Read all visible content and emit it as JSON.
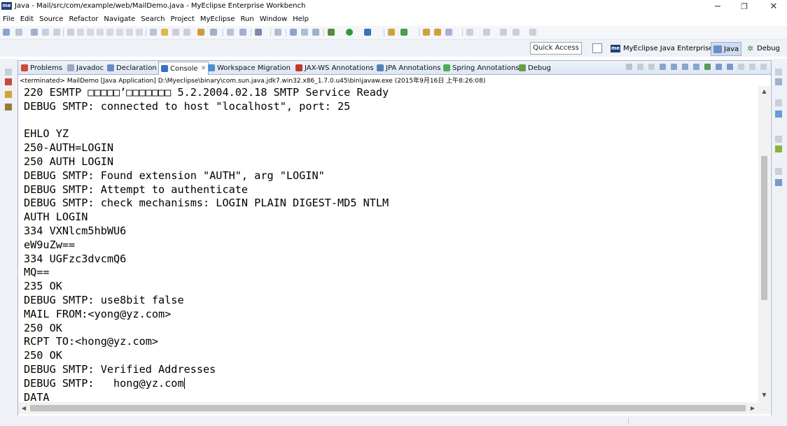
{
  "window": {
    "app_logo": "me",
    "title": "Java - Mail/src/com/example/web/MailDemo.java - MyEclipse Enterprise Workbench",
    "minimize": "−",
    "maximize": "❐",
    "close": "✕"
  },
  "menu": [
    "File",
    "Edit",
    "Source",
    "Refactor",
    "Navigate",
    "Search",
    "Project",
    "MyEclipse",
    "Run",
    "Window",
    "Help"
  ],
  "quick_access": "Quick Access",
  "perspectives": {
    "myeclipse": "MyEclipse Java Enterprise",
    "java": "Java",
    "debug": "Debug"
  },
  "view_tabs": [
    {
      "label": "Problems",
      "color": "#d04a3a"
    },
    {
      "label": "Javadoc",
      "color": "#9aa8c0"
    },
    {
      "label": "Declaration",
      "color": "#6a8ac8"
    },
    {
      "label": "Console",
      "color": "#3a6fc4",
      "active": true
    },
    {
      "label": "Workspace Migration",
      "color": "#4d8fd6"
    },
    {
      "label": "JAX-WS Annotations",
      "color": "#c0392b"
    },
    {
      "label": "JPA Annotations",
      "color": "#5a7fb8"
    },
    {
      "label": "Spring Annotations",
      "color": "#4caf50"
    },
    {
      "label": "Debug",
      "color": "#6a9a4a"
    }
  ],
  "console": {
    "launch_info": "<terminated> MailDemo [Java Application] D:\\Myeclipse\\binary\\com.sun.java.jdk7.win32.x86_1.7.0.u45\\bin\\javaw.exe (2015年9月16日 上午8:26:08)",
    "lines": [
      "220 ESMTP □□□□□’□□□□□□□ 5.2.2004.02.18 SMTP Service Ready",
      "DEBUG SMTP: connected to host \"localhost\", port: 25",
      "",
      "EHLO YZ",
      "250-AUTH=LOGIN",
      "250 AUTH LOGIN",
      "DEBUG SMTP: Found extension \"AUTH\", arg \"LOGIN\"",
      "DEBUG SMTP: Attempt to authenticate",
      "DEBUG SMTP: check mechanisms: LOGIN PLAIN DIGEST-MD5 NTLM",
      "AUTH LOGIN",
      "334 VXNlcm5hbWU6",
      "eW9uZw==",
      "334 UGFzc3dvcmQ6",
      "MQ==",
      "235 OK",
      "DEBUG SMTP: use8bit false",
      "MAIL FROM:<yong@yz.com>",
      "250 OK",
      "RCPT TO:<hong@yz.com>",
      "250 OK",
      "DEBUG SMTP: Verified Addresses",
      "DEBUG SMTP:   hong@yz.com",
      "DATA"
    ]
  }
}
